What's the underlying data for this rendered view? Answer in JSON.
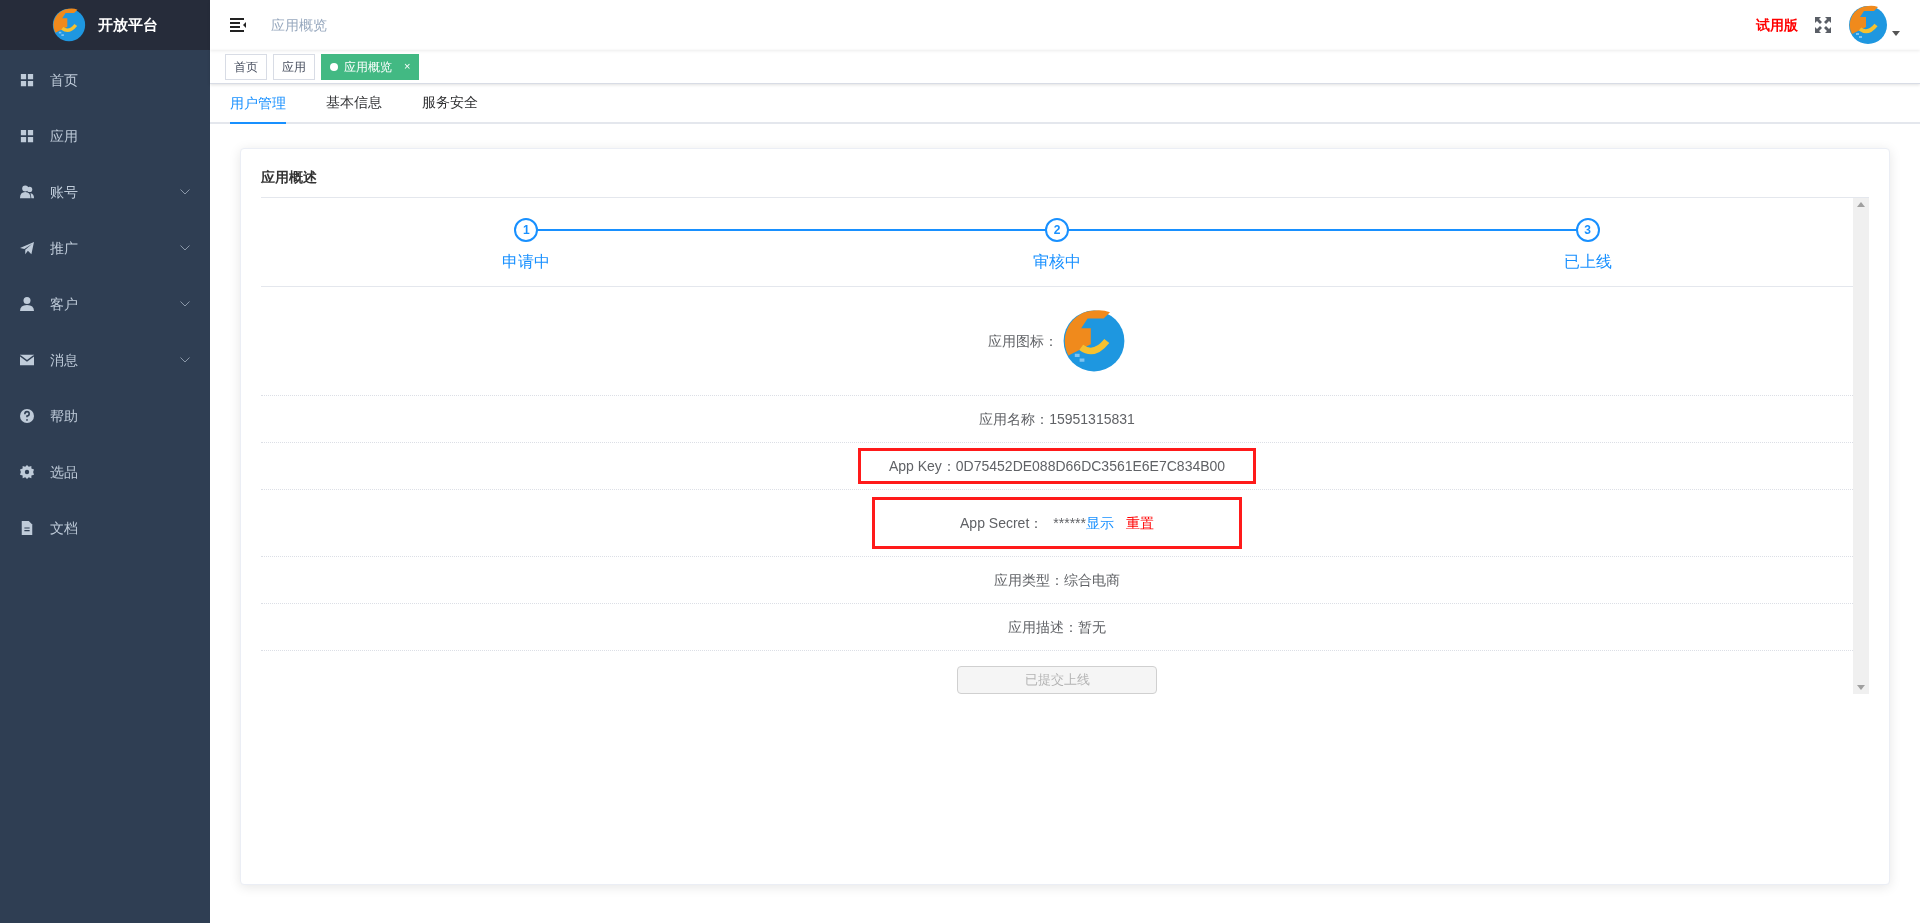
{
  "brand": {
    "title": "开放平台"
  },
  "sidebar": {
    "items": [
      {
        "label": "首页",
        "expandable": false
      },
      {
        "label": "应用",
        "expandable": false
      },
      {
        "label": "账号",
        "expandable": true
      },
      {
        "label": "推广",
        "expandable": true
      },
      {
        "label": "客户",
        "expandable": true
      },
      {
        "label": "消息",
        "expandable": true
      },
      {
        "label": "帮助",
        "expandable": false
      },
      {
        "label": "选品",
        "expandable": false
      },
      {
        "label": "文档",
        "expandable": false
      }
    ]
  },
  "header": {
    "breadcrumb": "应用概览",
    "trial_badge": "试用版"
  },
  "page_tabs": [
    {
      "label": "首页",
      "selected": false,
      "closable": false
    },
    {
      "label": "应用",
      "selected": false,
      "closable": false
    },
    {
      "label": "应用概览",
      "selected": true,
      "closable": true,
      "close": "×"
    }
  ],
  "sub_tabs": [
    {
      "label": "用户管理",
      "selected": true
    },
    {
      "label": "基本信息",
      "selected": false
    },
    {
      "label": "服务安全",
      "selected": false
    }
  ],
  "card": {
    "title": "应用概述",
    "steps": [
      {
        "number": "1",
        "label": "申请中"
      },
      {
        "number": "2",
        "label": "审核中"
      },
      {
        "number": "3",
        "label": "已上线"
      }
    ],
    "fields": [
      {
        "kind": "icon",
        "label": "应用图标："
      },
      {
        "kind": "text",
        "label": "应用名称：",
        "value": "15951315831"
      },
      {
        "kind": "text",
        "label": "App Key：",
        "value": "0D75452DE088D66DC3561E6E7C834B00",
        "highlighted": true
      },
      {
        "kind": "secret",
        "label": "App Secret：",
        "value": "******",
        "show_link": "显示",
        "reset_link": "重置",
        "highlighted": true
      },
      {
        "kind": "text",
        "label": "应用类型：",
        "value": "综合电商"
      },
      {
        "kind": "text",
        "label": "应用描述：",
        "value": "暂无"
      }
    ],
    "submit_button": {
      "label": "已提交上线",
      "disabled": true
    }
  }
}
